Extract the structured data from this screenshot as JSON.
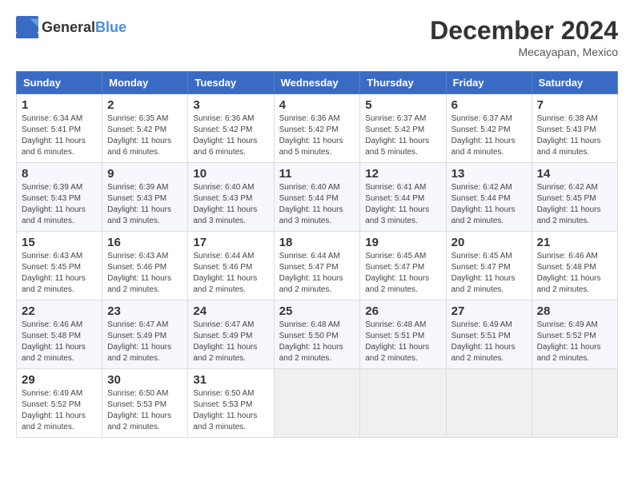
{
  "logo": {
    "text_general": "General",
    "text_blue": "Blue"
  },
  "title": {
    "month_year": "December 2024",
    "location": "Mecayapan, Mexico"
  },
  "days_of_week": [
    "Sunday",
    "Monday",
    "Tuesday",
    "Wednesday",
    "Thursday",
    "Friday",
    "Saturday"
  ],
  "weeks": [
    [
      {
        "day": "1",
        "info": "Sunrise: 6:34 AM\nSunset: 5:41 PM\nDaylight: 11 hours and 6 minutes."
      },
      {
        "day": "2",
        "info": "Sunrise: 6:35 AM\nSunset: 5:42 PM\nDaylight: 11 hours and 6 minutes."
      },
      {
        "day": "3",
        "info": "Sunrise: 6:36 AM\nSunset: 5:42 PM\nDaylight: 11 hours and 6 minutes."
      },
      {
        "day": "4",
        "info": "Sunrise: 6:36 AM\nSunset: 5:42 PM\nDaylight: 11 hours and 5 minutes."
      },
      {
        "day": "5",
        "info": "Sunrise: 6:37 AM\nSunset: 5:42 PM\nDaylight: 11 hours and 5 minutes."
      },
      {
        "day": "6",
        "info": "Sunrise: 6:37 AM\nSunset: 5:42 PM\nDaylight: 11 hours and 4 minutes."
      },
      {
        "day": "7",
        "info": "Sunrise: 6:38 AM\nSunset: 5:43 PM\nDaylight: 11 hours and 4 minutes."
      }
    ],
    [
      {
        "day": "8",
        "info": "Sunrise: 6:39 AM\nSunset: 5:43 PM\nDaylight: 11 hours and 4 minutes."
      },
      {
        "day": "9",
        "info": "Sunrise: 6:39 AM\nSunset: 5:43 PM\nDaylight: 11 hours and 3 minutes."
      },
      {
        "day": "10",
        "info": "Sunrise: 6:40 AM\nSunset: 5:43 PM\nDaylight: 11 hours and 3 minutes."
      },
      {
        "day": "11",
        "info": "Sunrise: 6:40 AM\nSunset: 5:44 PM\nDaylight: 11 hours and 3 minutes."
      },
      {
        "day": "12",
        "info": "Sunrise: 6:41 AM\nSunset: 5:44 PM\nDaylight: 11 hours and 3 minutes."
      },
      {
        "day": "13",
        "info": "Sunrise: 6:42 AM\nSunset: 5:44 PM\nDaylight: 11 hours and 2 minutes."
      },
      {
        "day": "14",
        "info": "Sunrise: 6:42 AM\nSunset: 5:45 PM\nDaylight: 11 hours and 2 minutes."
      }
    ],
    [
      {
        "day": "15",
        "info": "Sunrise: 6:43 AM\nSunset: 5:45 PM\nDaylight: 11 hours and 2 minutes."
      },
      {
        "day": "16",
        "info": "Sunrise: 6:43 AM\nSunset: 5:46 PM\nDaylight: 11 hours and 2 minutes."
      },
      {
        "day": "17",
        "info": "Sunrise: 6:44 AM\nSunset: 5:46 PM\nDaylight: 11 hours and 2 minutes."
      },
      {
        "day": "18",
        "info": "Sunrise: 6:44 AM\nSunset: 5:47 PM\nDaylight: 11 hours and 2 minutes."
      },
      {
        "day": "19",
        "info": "Sunrise: 6:45 AM\nSunset: 5:47 PM\nDaylight: 11 hours and 2 minutes."
      },
      {
        "day": "20",
        "info": "Sunrise: 6:45 AM\nSunset: 5:47 PM\nDaylight: 11 hours and 2 minutes."
      },
      {
        "day": "21",
        "info": "Sunrise: 6:46 AM\nSunset: 5:48 PM\nDaylight: 11 hours and 2 minutes."
      }
    ],
    [
      {
        "day": "22",
        "info": "Sunrise: 6:46 AM\nSunset: 5:48 PM\nDaylight: 11 hours and 2 minutes."
      },
      {
        "day": "23",
        "info": "Sunrise: 6:47 AM\nSunset: 5:49 PM\nDaylight: 11 hours and 2 minutes."
      },
      {
        "day": "24",
        "info": "Sunrise: 6:47 AM\nSunset: 5:49 PM\nDaylight: 11 hours and 2 minutes."
      },
      {
        "day": "25",
        "info": "Sunrise: 6:48 AM\nSunset: 5:50 PM\nDaylight: 11 hours and 2 minutes."
      },
      {
        "day": "26",
        "info": "Sunrise: 6:48 AM\nSunset: 5:51 PM\nDaylight: 11 hours and 2 minutes."
      },
      {
        "day": "27",
        "info": "Sunrise: 6:49 AM\nSunset: 5:51 PM\nDaylight: 11 hours and 2 minutes."
      },
      {
        "day": "28",
        "info": "Sunrise: 6:49 AM\nSunset: 5:52 PM\nDaylight: 11 hours and 2 minutes."
      }
    ],
    [
      {
        "day": "29",
        "info": "Sunrise: 6:49 AM\nSunset: 5:52 PM\nDaylight: 11 hours and 2 minutes."
      },
      {
        "day": "30",
        "info": "Sunrise: 6:50 AM\nSunset: 5:53 PM\nDaylight: 11 hours and 2 minutes."
      },
      {
        "day": "31",
        "info": "Sunrise: 6:50 AM\nSunset: 5:53 PM\nDaylight: 11 hours and 3 minutes."
      },
      null,
      null,
      null,
      null
    ]
  ]
}
